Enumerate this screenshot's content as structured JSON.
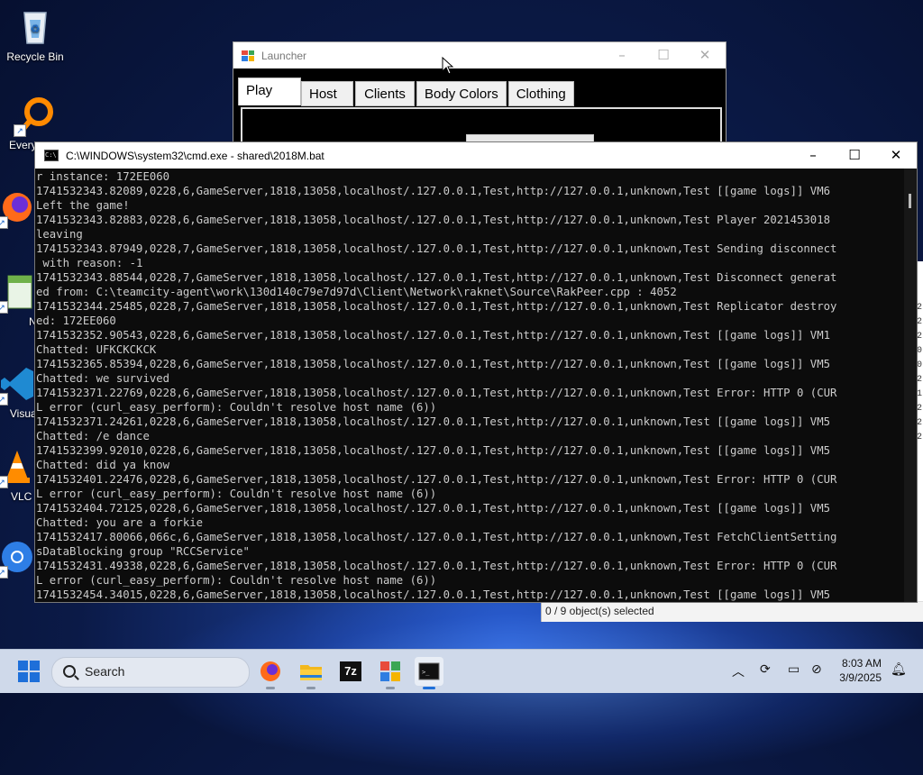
{
  "desktop": {
    "icons": [
      {
        "label": "Recycle Bin"
      },
      {
        "label": "Every"
      },
      {
        "label": "Fire"
      },
      {
        "label": "Notep"
      },
      {
        "label": "Visual Co"
      },
      {
        "label": "VLC r pla"
      },
      {
        "label": "Chro"
      }
    ]
  },
  "launcher": {
    "title": "Launcher",
    "tabs": [
      "Play",
      "Host",
      "Clients",
      "Body Colors",
      "Clothing"
    ],
    "active_tab": "Play"
  },
  "explorer": {
    "status": "0 / 9 object(s) selected",
    "digits": [
      "2",
      "2",
      "2",
      "0",
      "0",
      "2",
      "1",
      "2",
      "2",
      "2"
    ]
  },
  "cmd": {
    "title": "C:\\WINDOWS\\system32\\cmd.exe - shared\\2018M.bat",
    "lines": [
      "r instance: 172EE060",
      "1741532343.82089,0228,6,GameServer,1818,13058,localhost/.127.0.0.1,Test,http://127.0.0.1,unknown,Test [[game logs]] VM6",
      "Left the game!",
      "1741532343.82883,0228,6,GameServer,1818,13058,localhost/.127.0.0.1,Test,http://127.0.0.1,unknown,Test Player 2021453018",
      "leaving",
      "1741532343.87949,0228,7,GameServer,1818,13058,localhost/.127.0.0.1,Test,http://127.0.0.1,unknown,Test Sending disconnect",
      " with reason: -1",
      "1741532343.88544,0228,7,GameServer,1818,13058,localhost/.127.0.0.1,Test,http://127.0.0.1,unknown,Test Disconnect generat",
      "ed from: C:\\teamcity-agent\\work\\130d140c79e7d97d\\Client\\Network\\raknet\\Source\\RakPeer.cpp : 4052",
      "1741532344.25485,0228,7,GameServer,1818,13058,localhost/.127.0.0.1,Test,http://127.0.0.1,unknown,Test Replicator destroy",
      "ed: 172EE060",
      "1741532352.90543,0228,6,GameServer,1818,13058,localhost/.127.0.0.1,Test,http://127.0.0.1,unknown,Test [[game logs]] VM1",
      "Chatted: UFKCKCKCK",
      "1741532365.85394,0228,6,GameServer,1818,13058,localhost/.127.0.0.1,Test,http://127.0.0.1,unknown,Test [[game logs]] VM5",
      "Chatted: we survived",
      "1741532371.22769,0228,6,GameServer,1818,13058,localhost/.127.0.0.1,Test,http://127.0.0.1,unknown,Test Error: HTTP 0 (CUR",
      "L error (curl_easy_perform): Couldn't resolve host name (6))",
      "1741532371.24261,0228,6,GameServer,1818,13058,localhost/.127.0.0.1,Test,http://127.0.0.1,unknown,Test [[game logs]] VM5",
      "Chatted: /e dance",
      "1741532399.92010,0228,6,GameServer,1818,13058,localhost/.127.0.0.1,Test,http://127.0.0.1,unknown,Test [[game logs]] VM5",
      "Chatted: did ya know",
      "1741532401.22476,0228,6,GameServer,1818,13058,localhost/.127.0.0.1,Test,http://127.0.0.1,unknown,Test Error: HTTP 0 (CUR",
      "L error (curl_easy_perform): Couldn't resolve host name (6))",
      "1741532404.72125,0228,6,GameServer,1818,13058,localhost/.127.0.0.1,Test,http://127.0.0.1,unknown,Test [[game logs]] VM5",
      "Chatted: you are a forkie",
      "1741532417.80066,066c,6,GameServer,1818,13058,localhost/.127.0.0.1,Test,http://127.0.0.1,unknown,Test FetchClientSetting",
      "sDataBlocking group \"RCCService\"",
      "1741532431.49338,0228,6,GameServer,1818,13058,localhost/.127.0.0.1,Test,http://127.0.0.1,unknown,Test Error: HTTP 0 (CUR",
      "L error (curl_easy_perform): Couldn't resolve host name (6))",
      "1741532454.34015,0228,6,GameServer,1818,13058,localhost/.127.0.0.1,Test,http://127.0.0.1,unknown,Test [[game logs]] VM5"
    ]
  },
  "taskbar": {
    "search_label": "Search",
    "zip_label": "7z",
    "time": "8:03 AM",
    "date": "3/9/2025"
  },
  "colors": {
    "console_bg": "#0c0c0c",
    "console_text": "#cccccc",
    "taskbar_bg": "#cfd9ea",
    "accent": "#1e6fd9"
  }
}
